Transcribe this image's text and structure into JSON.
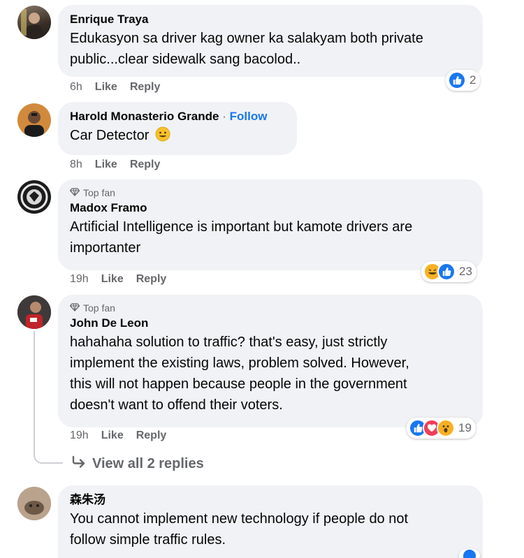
{
  "comments": [
    {
      "author": "Enrique Traya",
      "text_lines": [
        "Edukasyon sa driver kag owner ka salakyam both private",
        "public...clear sidewalk sang bacolod.."
      ],
      "time": "6h",
      "like_label": "Like",
      "reply_label": "Reply",
      "reaction_count": "2",
      "reactions": [
        "like"
      ]
    },
    {
      "author": "Harold Monasterio Grande",
      "separator": "·",
      "follow_label": "Follow",
      "text": "Car Detector",
      "emoji": "smiling-face",
      "time": "8h",
      "like_label": "Like",
      "reply_label": "Reply"
    },
    {
      "badge": "Top fan",
      "author": "Madox Framo",
      "text_lines": [
        "Artificial Intelligence is important but kamote drivers are",
        "importanter"
      ],
      "time": "19h",
      "like_label": "Like",
      "reply_label": "Reply",
      "reaction_count": "23",
      "reactions": [
        "haha",
        "like"
      ]
    },
    {
      "badge": "Top fan",
      "author": "John De Leon",
      "text_lines": [
        "hahahaha solution to traffic? that's easy, just strictly",
        "implement the existing laws, problem solved. However,",
        "this will not happen because people in the government",
        "doesn't want to offend their voters."
      ],
      "time": "19h",
      "like_label": "Like",
      "reply_label": "Reply",
      "reaction_count": "19",
      "reactions": [
        "like",
        "love",
        "wow"
      ],
      "view_replies_label": "View all 2 replies"
    },
    {
      "author": "森朱汤",
      "text_lines": [
        "You cannot implement new technology if people do not",
        "follow simple traffic rules."
      ]
    }
  ],
  "colors": {
    "bubble": "#f0f2f5",
    "meta_text": "#65676b",
    "link_blue": "#1877f2",
    "love_red": "#f33e58",
    "emoji_yellow": "#f7b125"
  }
}
